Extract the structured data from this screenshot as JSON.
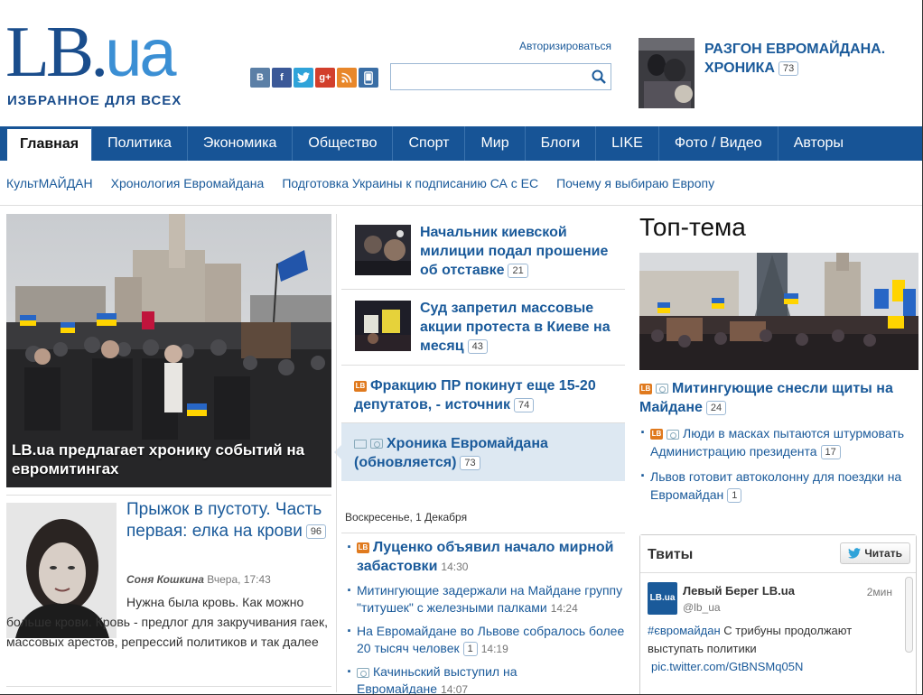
{
  "header": {
    "logo_main": "LB.",
    "logo_ua": "ua",
    "tagline": "ИЗБРАННОЕ ДЛЯ ВСЕХ",
    "login": "Авторизироваться",
    "search_placeholder": "",
    "social": [
      {
        "icon": "vk-icon",
        "label": "В",
        "color": "#5b7fa6"
      },
      {
        "icon": "facebook-icon",
        "label": "f",
        "color": "#3b5998"
      },
      {
        "icon": "twitter-icon",
        "label": "t",
        "color": "#2fa3d9"
      },
      {
        "icon": "google-plus-icon",
        "label": "g+",
        "color": "#d23f2c"
      },
      {
        "icon": "rss-icon",
        "label": "RSS",
        "color": "#e8872a"
      },
      {
        "icon": "mobile-icon",
        "label": "▯",
        "color": "#3a6ea5"
      }
    ],
    "promo": {
      "title": "РАЗГОН ЕВРОМАЙДАНА. ХРОНИКА",
      "count": "73"
    }
  },
  "nav": {
    "items": [
      "Главная",
      "Политика",
      "Экономика",
      "Общество",
      "Спорт",
      "Мир",
      "Блоги",
      "LIKE",
      "Фото / Видео",
      "Авторы"
    ]
  },
  "subnav": {
    "items": [
      "КультМАЙДАН",
      "Хронология Евромайдана",
      "Подготовка Украины к подписанию СА с ЕС",
      "Почему я выбираю Европу"
    ]
  },
  "hero": {
    "caption": "LB.ua предлагает хронику событий на евромитингах"
  },
  "article2": {
    "title": "Прыжок в пустоту. Часть первая: елка на крови",
    "count": "96",
    "author": "Соня Кошкина",
    "time": "Вчера, 17:43",
    "text": "Нужна была кровь. Как можно больше крови. Кровь - предлог для закручивания гаек, массовых арестов, репрессий политиков и так далее"
  },
  "middle": {
    "news": [
      {
        "title": "Начальник киевской милиции подал прошение об отставке",
        "count": "21"
      },
      {
        "title": "Суд запретил массовые акции протеста в Киеве на месяц",
        "count": "43"
      },
      {
        "title": "Фракцию ПР покинут еще 15-20 депутатов, - источник",
        "count": "74"
      },
      {
        "title": "Хроника Евромайдана (обновляется)",
        "count": "73"
      }
    ],
    "date": "Воскресенье, 1 Декабря",
    "feed": [
      {
        "title": "Луценко объявил начало мирной забастовки",
        "time": "14:30"
      },
      {
        "title": "Митингующие задержали на Майдане группу \"титушек\" с железными палками",
        "time": "14:24"
      },
      {
        "title": "На Евромайдане во Львове собралось более 20 тысяч человек",
        "count": "1",
        "time": "14:19"
      },
      {
        "title": "Качиньский выступил на Евромайдане",
        "time": "14:07"
      }
    ]
  },
  "right": {
    "heading": "Топ-тема",
    "main_title": "Митингующие снесли щиты на Майдане",
    "main_count": "24",
    "items": [
      {
        "title": "Люди в масках пытаются штурмовать Администрацию президента",
        "count": "17"
      },
      {
        "title": "Львов готовит автоколонну для поездки на Евромайдан",
        "count": "1"
      }
    ]
  },
  "tweets": {
    "title": "Твиты",
    "follow": "Читать",
    "avatar_text": "LB.ua",
    "name": "Левый Берег LB.ua",
    "handle": "@lb_ua",
    "time": "2мин",
    "hashtag": "#євромайдан",
    "text": " С трибуны продолжают выступать политики",
    "link": "pic.twitter.com/GtBNSMq05N"
  }
}
